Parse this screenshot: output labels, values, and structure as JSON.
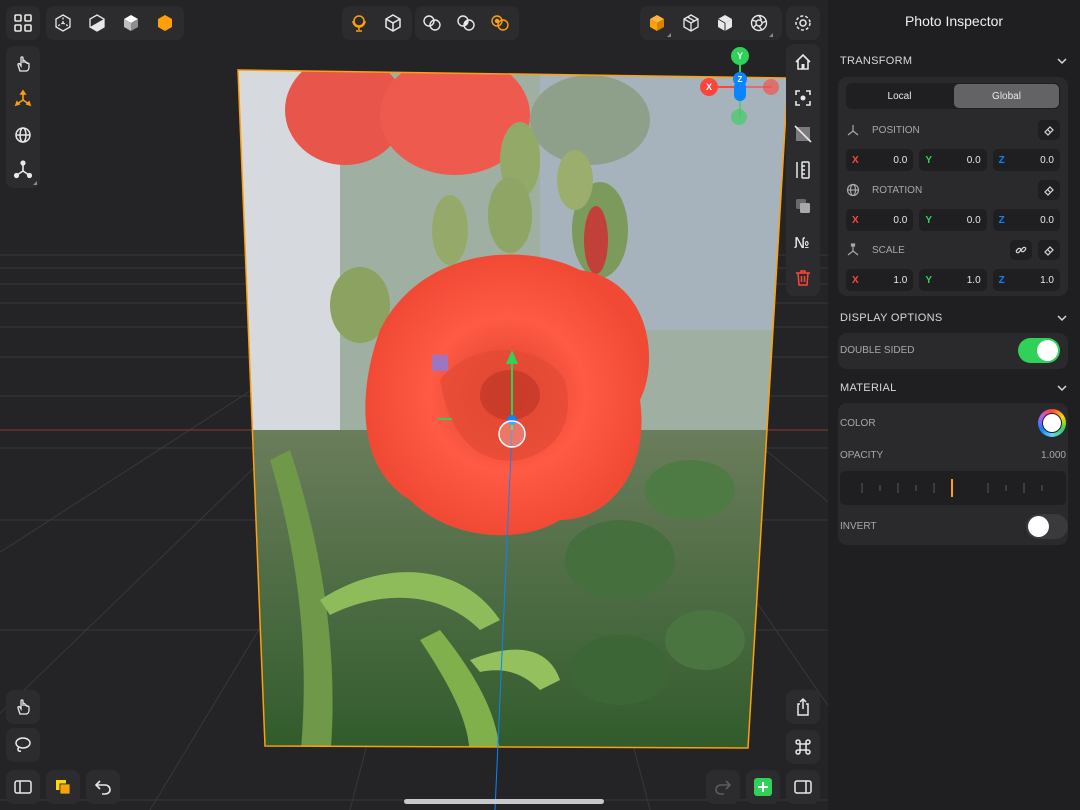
{
  "inspector": {
    "title": "Photo Inspector",
    "transform": {
      "header": "TRANSFORM",
      "space_options": [
        "Local",
        "Global"
      ],
      "space_selected": "Global",
      "position": {
        "label": "POSITION",
        "x": "0.0",
        "y": "0.0",
        "z": "0.0"
      },
      "rotation": {
        "label": "ROTATION",
        "x": "0.0",
        "y": "0.0",
        "z": "0.0"
      },
      "scale": {
        "label": "SCALE",
        "x": "1.0",
        "y": "1.0",
        "z": "1.0"
      },
      "axis_labels": {
        "x": "X",
        "y": "Y",
        "z": "Z"
      }
    },
    "display_options": {
      "header": "DISPLAY OPTIONS",
      "double_sided_label": "DOUBLE SIDED",
      "double_sided": true
    },
    "material": {
      "header": "MATERIAL",
      "color_label": "COLOR",
      "opacity_label": "OPACITY",
      "opacity_value": "1.000",
      "opacity": 1.0,
      "invert_label": "INVERT",
      "invert": false
    }
  },
  "gizmo": {
    "x": "X",
    "y": "Y",
    "z": "Z"
  },
  "colors": {
    "accent": "#ff9f0a",
    "axis_x": "#ff453a",
    "axis_y": "#30d158",
    "axis_z": "#0a84ff",
    "toggle_on": "#30d158",
    "add_button": "#30d158"
  },
  "icons": {
    "top_left": [
      "grid-icon",
      "wireframe-cube-icon",
      "half-shaded-cube-icon",
      "solid-cube-icon",
      "hexagon-icon"
    ],
    "top_center": [
      "globe-stand-icon",
      "cube-icon",
      "boolean-union-icon",
      "boolean-intersect-icon",
      "boolean-subtract-icon"
    ],
    "top_right": [
      "orange-cube-icon",
      "mesh-cube-icon",
      "split-cube-icon",
      "aperture-icon",
      "settings-icon"
    ],
    "left_tools": [
      "touch-icon",
      "move-axes-icon",
      "rotate-icon",
      "pivot-icon"
    ],
    "right_tools": [
      "home-icon",
      "focus-icon",
      "hide-icon",
      "measure-icon",
      "duplicate-icon",
      "numbering-icon",
      "trash-icon"
    ],
    "bottom": [
      "hand-icon",
      "lasso-icon",
      "sidebar-left-icon",
      "layers-icon",
      "undo-icon",
      "redo-icon",
      "add-icon",
      "sidebar-right-icon",
      "share-icon",
      "command-icon"
    ]
  }
}
